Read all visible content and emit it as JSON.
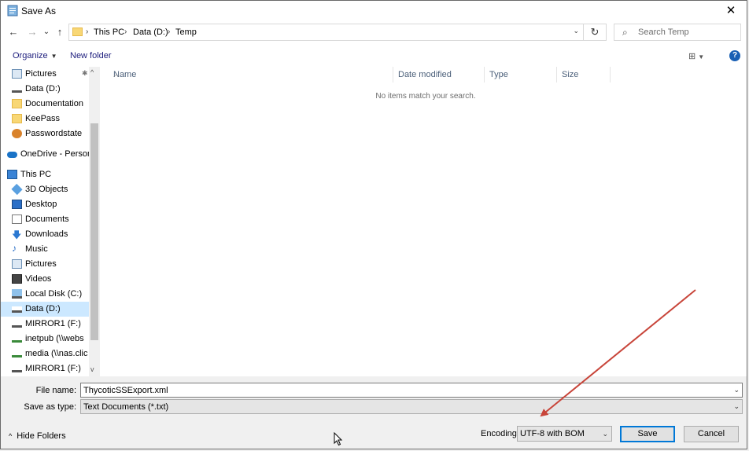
{
  "window": {
    "title": "Save As",
    "close_glyph": "✕"
  },
  "nav": {
    "back": "←",
    "forward": "→",
    "recent": "⌄",
    "up": "↑"
  },
  "breadcrumbs": [
    "This PC",
    "Data (D:)",
    "Temp"
  ],
  "address": {
    "dropdown": "⌄",
    "refresh": "↻"
  },
  "search": {
    "placeholder": "Search Temp",
    "icon": "⌕"
  },
  "toolbar": {
    "organize": "Organize",
    "new_folder": "New folder",
    "view_glyph": "⊞",
    "help_glyph": "?"
  },
  "sidebar": {
    "items": [
      {
        "label": "Pictures",
        "icon": "pictures-icon"
      },
      {
        "label": "Data (D:)",
        "icon": "drive-icon"
      },
      {
        "label": "Documentation",
        "icon": "folder-icon"
      },
      {
        "label": "KeePass",
        "icon": "folder-icon"
      },
      {
        "label": "Passwordstate",
        "icon": "warning-folder-icon"
      },
      {
        "label": "OneDrive - Person",
        "icon": "cloud-icon"
      },
      {
        "label": "This PC",
        "icon": "computer-icon"
      },
      {
        "label": "3D Objects",
        "icon": "3d-objects-icon"
      },
      {
        "label": "Desktop",
        "icon": "desktop-icon"
      },
      {
        "label": "Documents",
        "icon": "documents-icon"
      },
      {
        "label": "Downloads",
        "icon": "download-icon"
      },
      {
        "label": "Music",
        "icon": "music-icon"
      },
      {
        "label": "Pictures",
        "icon": "pictures-icon"
      },
      {
        "label": "Videos",
        "icon": "videos-icon"
      },
      {
        "label": "Local Disk (C:)",
        "icon": "system-drive-icon"
      },
      {
        "label": "Data (D:)",
        "icon": "drive-icon"
      },
      {
        "label": "MIRROR1 (F:)",
        "icon": "drive-icon"
      },
      {
        "label": "inetpub (\\\\webs",
        "icon": "network-drive-icon"
      },
      {
        "label": "media (\\\\nas.clic",
        "icon": "network-drive-icon"
      },
      {
        "label": "MIRROR1 (F:)",
        "icon": "drive-icon"
      }
    ],
    "selected_index": 15
  },
  "columns": [
    "Name",
    "Date modified",
    "Type",
    "Size"
  ],
  "empty_message": "No items match your search.",
  "form": {
    "file_name_label": "File name:",
    "file_name_value": "ThycoticSSExport.xml",
    "type_label": "Save as type:",
    "type_value": "Text Documents (*.txt)",
    "encoding_label": "Encoding:",
    "encoding_value": "UTF-8 with BOM",
    "save_label": "Save",
    "cancel_label": "Cancel",
    "hide_folders_label": "Hide Folders"
  },
  "annotation_color": "#c8453a"
}
